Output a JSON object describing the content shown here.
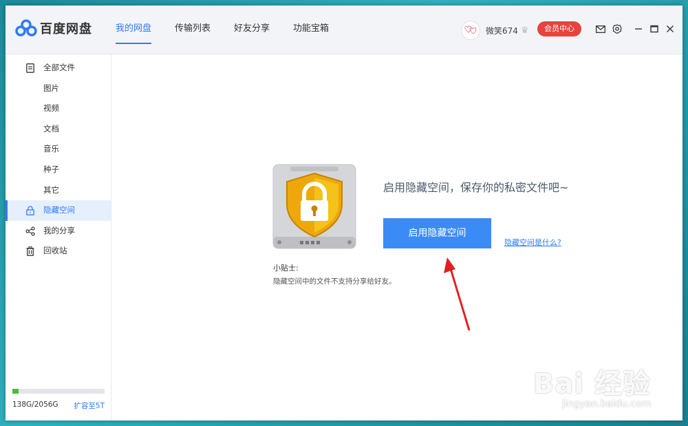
{
  "app": {
    "title": "百度网盘"
  },
  "nav": {
    "tabs": [
      {
        "label": "我的网盘",
        "active": true
      },
      {
        "label": "传输列表"
      },
      {
        "label": "好友分享"
      },
      {
        "label": "功能宝箱"
      }
    ]
  },
  "user": {
    "name": "微笑674",
    "vip_label": "会员中心"
  },
  "toolbar_icons": [
    "mail-icon",
    "gear-icon",
    "minimize-icon",
    "maximize-icon",
    "close-icon"
  ],
  "sidebar": {
    "items": [
      {
        "label": "全部文件",
        "icon": "document-icon"
      },
      {
        "label": "图片"
      },
      {
        "label": "视频"
      },
      {
        "label": "文档"
      },
      {
        "label": "音乐"
      },
      {
        "label": "种子"
      },
      {
        "label": "其它"
      },
      {
        "label": "隐藏空间",
        "icon": "lock-icon",
        "active": true
      },
      {
        "label": "我的分享",
        "icon": "share-icon"
      },
      {
        "label": "回收站",
        "icon": "trash-icon"
      }
    ]
  },
  "quota": {
    "text": "138G/2056G",
    "expand_label": "扩容至5T",
    "used_fraction": 0.067
  },
  "main": {
    "headline": "启用隐藏空间，保存你的私密文件吧~",
    "button_label": "启用隐藏空间",
    "help_link": "隐藏空间是什么?",
    "tip_title": "小贴士:",
    "tip_text": "隐藏空间中的文件不支持分享给好友。"
  },
  "watermark": {
    "main": "Bai 经验",
    "sub": "jingyan.baidu.com"
  },
  "colors": {
    "accent": "#2f7bf5",
    "vip": "#e6443c",
    "button": "#3b8bf7",
    "arrow": "#e02020",
    "quota": "#4cba3c"
  }
}
